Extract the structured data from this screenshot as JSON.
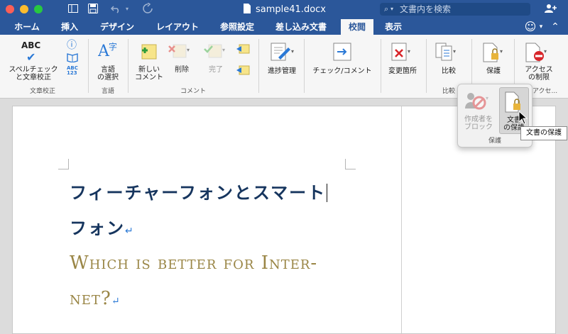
{
  "window": {
    "title": "sample41.docx",
    "search_placeholder": "文書内を検索"
  },
  "tabs": [
    {
      "label": "ホーム"
    },
    {
      "label": "挿入"
    },
    {
      "label": "デザイン"
    },
    {
      "label": "レイアウト"
    },
    {
      "label": "参照設定"
    },
    {
      "label": "差し込み文書"
    },
    {
      "label": "校閲",
      "active": true
    },
    {
      "label": "表示"
    }
  ],
  "ribbon": {
    "spelling": {
      "label1": "スペルチェック",
      "label2": "と文章校正"
    },
    "language": {
      "label1": "言語",
      "label2": "の選択"
    },
    "new_comment": {
      "label1": "新しい",
      "label2": "コメント"
    },
    "delete": {
      "label": "削除"
    },
    "done": {
      "label": "完了"
    },
    "track_changes": {
      "label": "進捗管理"
    },
    "check_comment": {
      "label": "チェック/コメント"
    },
    "changes": {
      "label": "変更箇所"
    },
    "compare": {
      "label": "比較"
    },
    "protect": {
      "label": "保護"
    },
    "restrict_access": {
      "label1": "アクセス",
      "label2": "の制限"
    },
    "groups": {
      "proofing": "文章校正",
      "language": "言語",
      "comments": "コメント",
      "compare": "比較",
      "access": "アクセ..."
    }
  },
  "popup": {
    "block_authors": {
      "label1": "作成者を",
      "label2": "ブロック"
    },
    "protect_document": {
      "label1": "文書",
      "label2": "の保護"
    },
    "group_label": "保護"
  },
  "tooltip": "文書の保護",
  "document": {
    "heading_line1": "フィーチャーフォンとスマート",
    "heading_line2": "フォン",
    "subheading_line1": "Which is better for Inter-",
    "subheading_line2": "net?",
    "return_mark": "↵"
  },
  "colors": {
    "brand": "#2b579a",
    "heading": "#16355e",
    "subheading": "#9a8646"
  }
}
